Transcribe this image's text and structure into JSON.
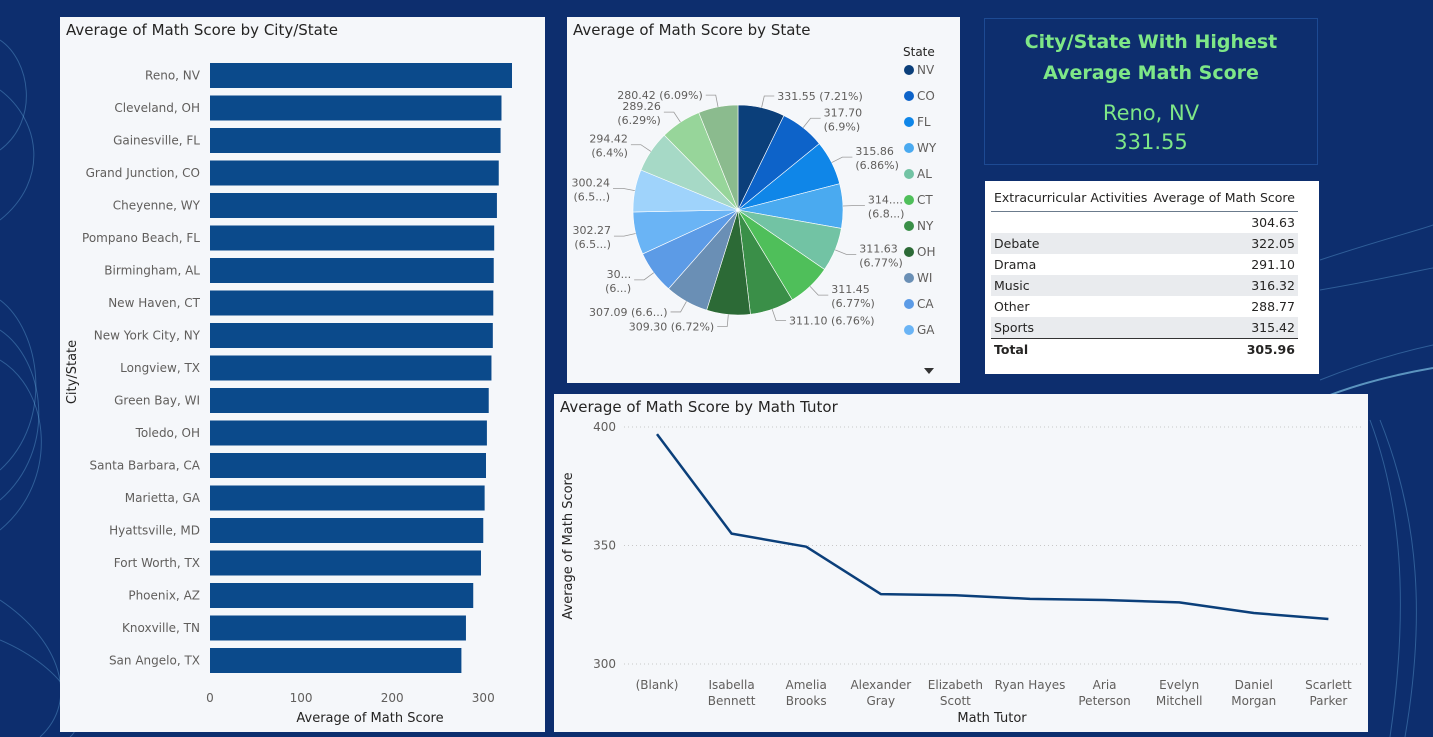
{
  "bar_panel": {
    "title": "Average of Math Score by City/State"
  },
  "pie_panel": {
    "title": "Average of Math Score by State",
    "legend_title": "State"
  },
  "line_panel": {
    "title": "Average of Math Score by Math Tutor"
  },
  "card": {
    "title_line1": "City/State With Highest",
    "title_line2": "Average Math Score",
    "city": "Reno, NV",
    "value": "331.55"
  },
  "table": {
    "headers": [
      "Extracurricular Activities",
      "Average of Math Score"
    ],
    "rows": [
      [
        "",
        "304.63"
      ],
      [
        "Debate",
        "322.05"
      ],
      [
        "Drama",
        "291.10"
      ],
      [
        "Music",
        "316.32"
      ],
      [
        "Other",
        "288.77"
      ],
      [
        "Sports",
        "315.42"
      ]
    ],
    "total": [
      "Total",
      "305.96"
    ]
  },
  "colors": {
    "background": "#0d2e6e",
    "bar": "#0b4a8b",
    "line": "#0b3f7a",
    "card_text": "#7ee787"
  },
  "chart_data": [
    {
      "type": "bar",
      "orientation": "horizontal",
      "title": "Average of Math Score by City/State",
      "xlabel": "Average of Math Score",
      "ylabel": "City/State",
      "xlim": [
        0,
        331.55
      ],
      "xticks": [
        "0",
        "100",
        "200",
        "300"
      ],
      "categories": [
        "Reno, NV",
        "Cleveland, OH",
        "Gainesville, FL",
        "Grand Junction, CO",
        "Cheyenne, WY",
        "Pompano Beach, FL",
        "Birmingham, AL",
        "New Haven, CT",
        "New York City, NY",
        "Longview, TX",
        "Green Bay, WI",
        "Toledo, OH",
        "Santa Barbara, CA",
        "Marietta, GA",
        "Hyattsville, MD",
        "Fort Worth, TX",
        "Phoenix, AZ",
        "Knoxville, TN",
        "San Angelo, TX"
      ],
      "values": [
        331.55,
        320,
        319,
        317,
        315,
        312,
        311.5,
        311,
        310.5,
        309,
        306,
        304,
        303,
        301.5,
        300,
        297.5,
        289,
        281,
        276
      ]
    },
    {
      "type": "pie",
      "title": "Average of Math Score by State",
      "legend_title": "State",
      "slices": [
        {
          "name": "NV",
          "value": 331.55,
          "label": "331.55 (7.21%)",
          "color": "#0b3f7a"
        },
        {
          "name": "CO",
          "value": 317.7,
          "label": "317.70 (6.9%)",
          "color": "#0d63c9"
        },
        {
          "name": "FL",
          "value": 315.86,
          "label": "315.86 (6.86%)",
          "color": "#0f86e8"
        },
        {
          "name": "WY",
          "value": 314.5,
          "label": "314.... (6.8...)",
          "color": "#4aaaf0"
        },
        {
          "name": "AL",
          "value": 311.63,
          "label": "311.63 (6.77%)",
          "color": "#72c3a4"
        },
        {
          "name": "CT",
          "value": 311.45,
          "label": "311.45 (6.77%)",
          "color": "#4fbf5a"
        },
        {
          "name": "NY",
          "value": 311.1,
          "label": "311.10 (6.76%)",
          "color": "#3a8f48"
        },
        {
          "name": "OH",
          "value": 309.3,
          "label": "309.30 (6.72%)",
          "color": "#2c6a36"
        },
        {
          "name": "WI",
          "value": 307.09,
          "label": "307.09 (6.6...)",
          "color": "#6a8fb5"
        },
        {
          "name": "CA",
          "value": 305,
          "label": "30... (6...)",
          "color": "#5c9be6"
        },
        {
          "name": "GA",
          "value": 302.27,
          "label": "302.27 (6.5...)",
          "color": "#6ab4f5"
        },
        {
          "name": "",
          "value": 300.24,
          "label": "300.24 (6.5...)",
          "color": "#9fd3fb"
        },
        {
          "name": "",
          "value": 294.42,
          "label": "294.42 (6.4%)",
          "color": "#a6d9c6"
        },
        {
          "name": "",
          "value": 289.26,
          "label": "289.26 (6.29%)",
          "color": "#97d59a"
        },
        {
          "name": "",
          "value": 280.42,
          "label": "280.42 (6.09%)",
          "color": "#8bbb8e"
        }
      ]
    },
    {
      "type": "line",
      "title": "Average of Math Score by Math Tutor",
      "xlabel": "Math Tutor",
      "ylabel": "Average of Math Score",
      "ylim": [
        300,
        400
      ],
      "yticks": [
        300,
        350,
        400
      ],
      "categories": [
        "(Blank)",
        "Isabella Bennett",
        "Amelia Brooks",
        "Alexander Gray",
        "Elizabeth Scott",
        "Ryan Hayes",
        "Aria Peterson",
        "Evelyn Mitchell",
        "Daniel Morgan",
        "Scarlett Parker"
      ],
      "values": [
        397,
        355,
        349.5,
        329.5,
        329,
        327.5,
        327,
        326,
        321.5,
        319
      ]
    }
  ]
}
